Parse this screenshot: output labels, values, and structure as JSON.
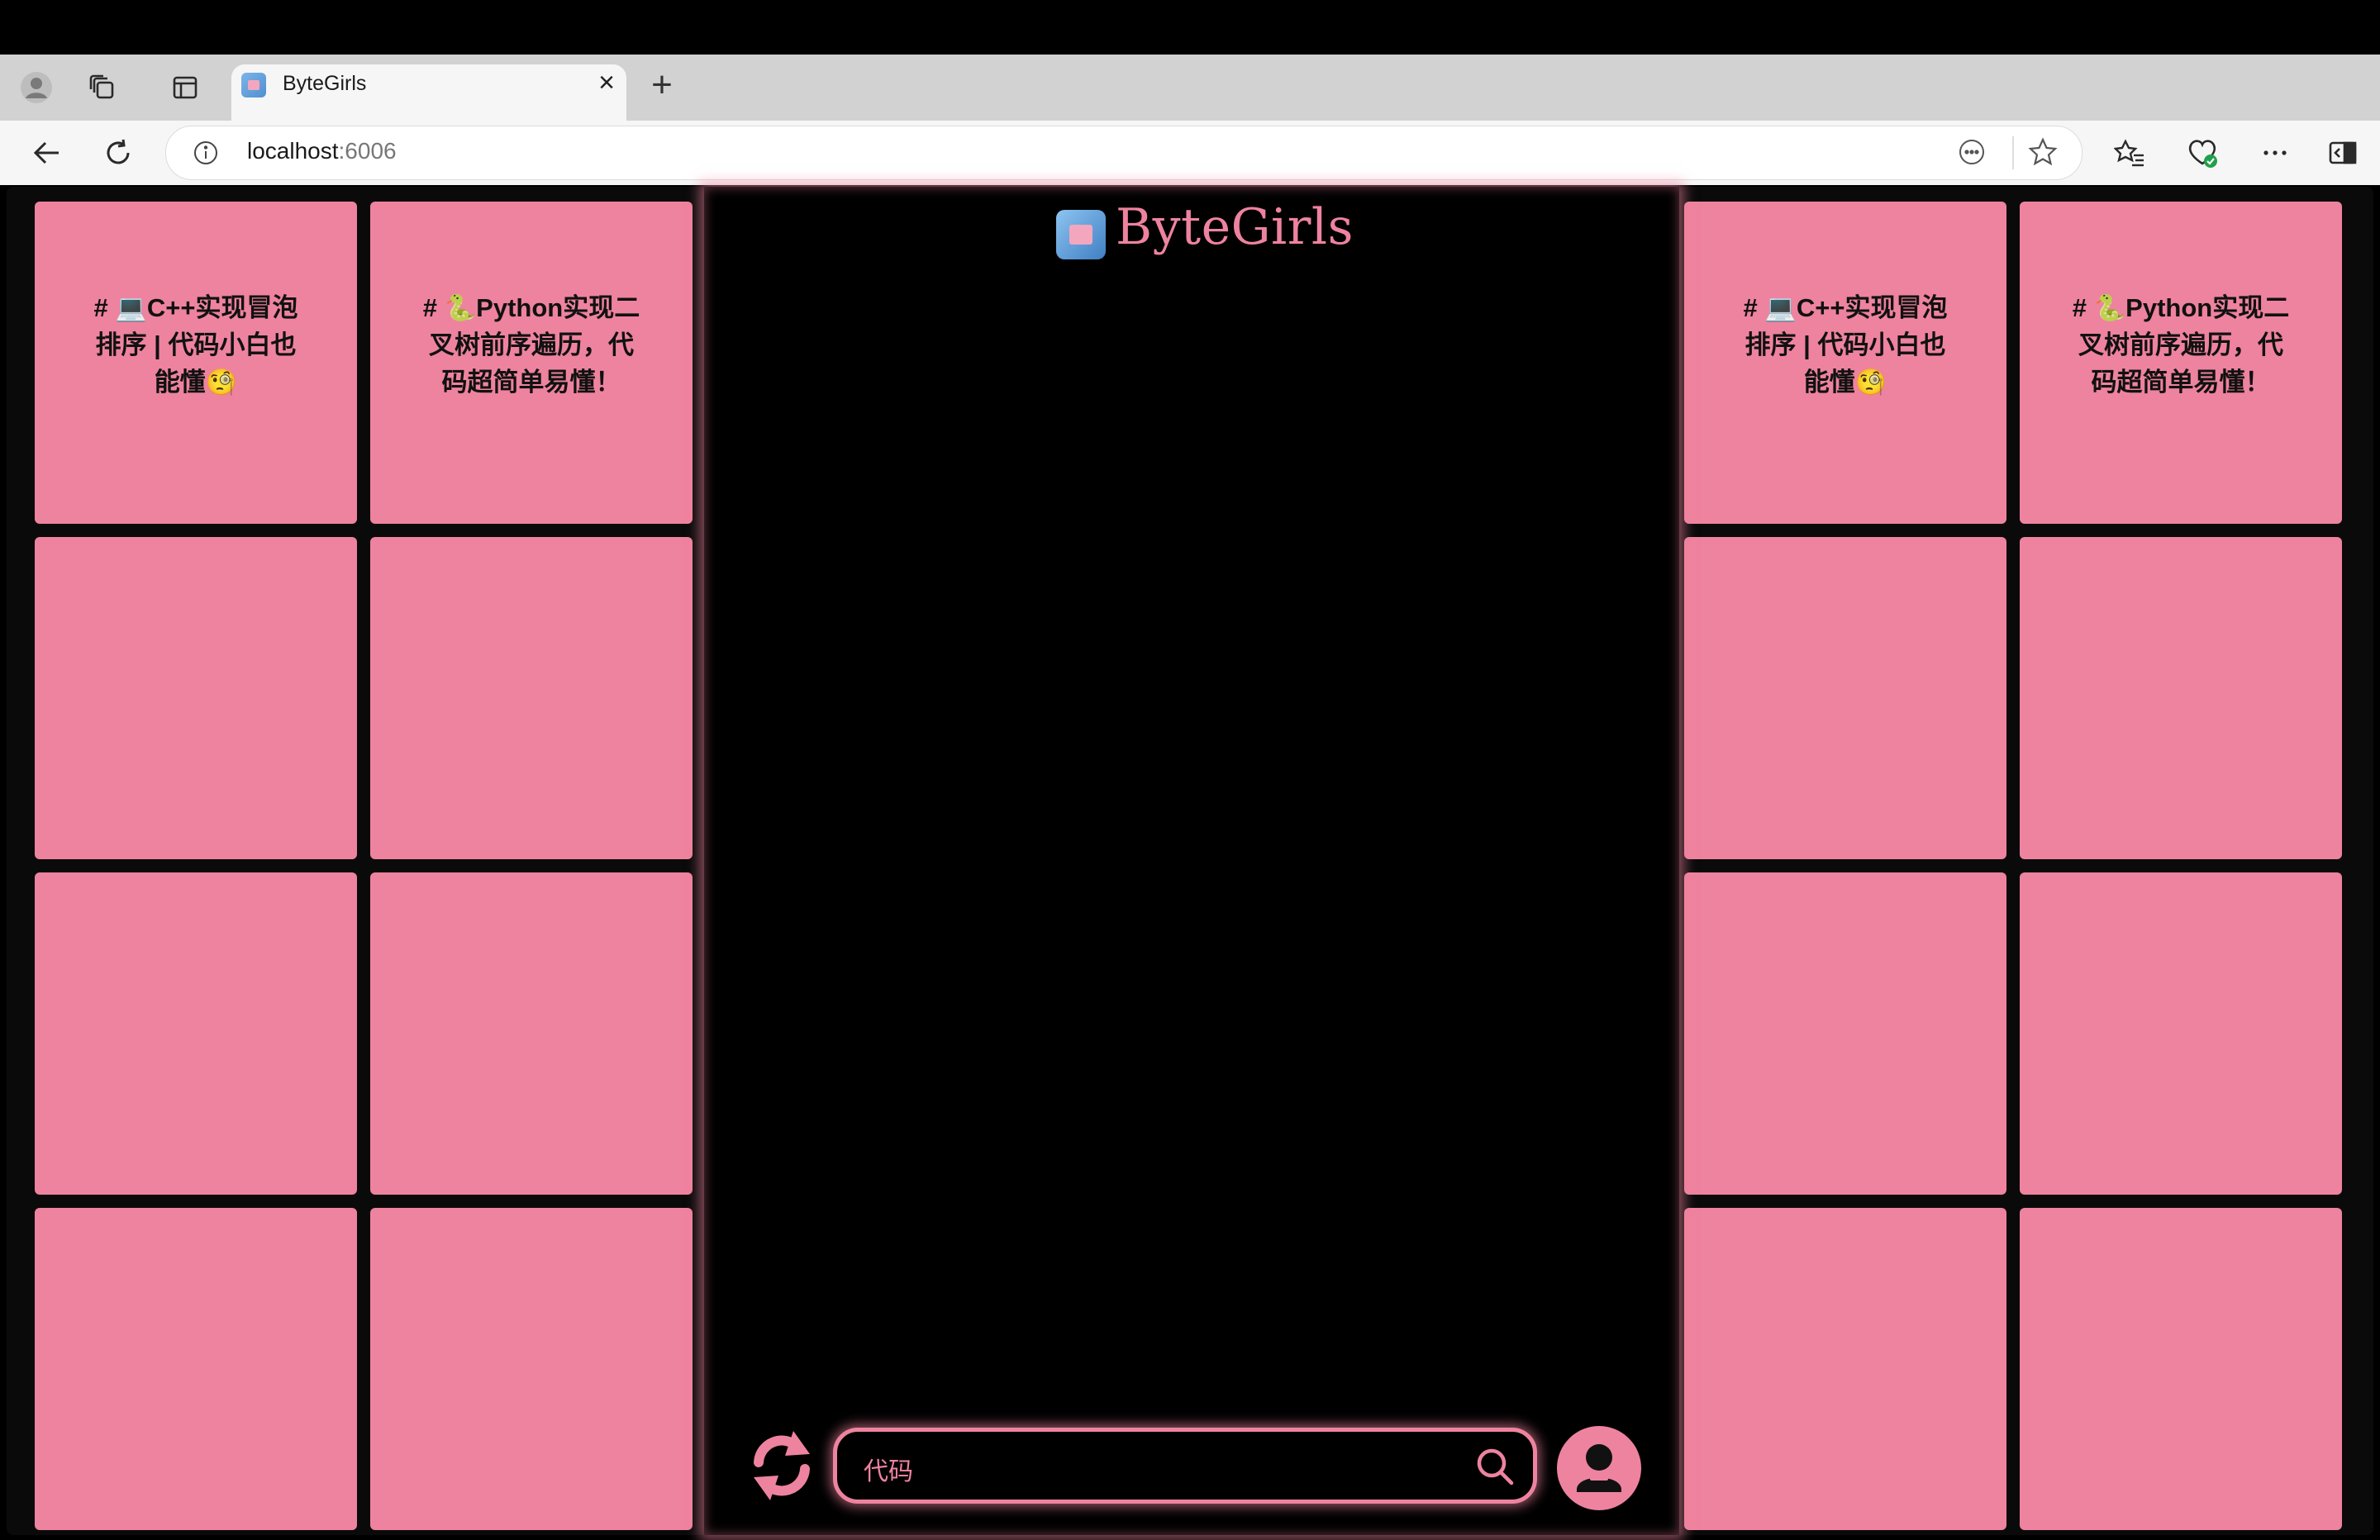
{
  "browser": {
    "tab_title": "ByteGirls",
    "url_host": "localhost",
    "url_port": ":6006",
    "new_tab_label": "+",
    "close_label": "×"
  },
  "header": {
    "logo_text": "ByteGirls"
  },
  "tiles": {
    "cpp": "# 💻C++实现冒泡排序 | 代码小白也能懂🧐",
    "python": "# 🐍Python实现二叉树前序遍历，代码超简单易懂！"
  },
  "search": {
    "value": "代码"
  },
  "colors": {
    "accent": "#ee839f",
    "background": "#000000"
  },
  "icons": {
    "refresh": "refresh-icon",
    "search": "search-icon",
    "user": "user-icon"
  }
}
